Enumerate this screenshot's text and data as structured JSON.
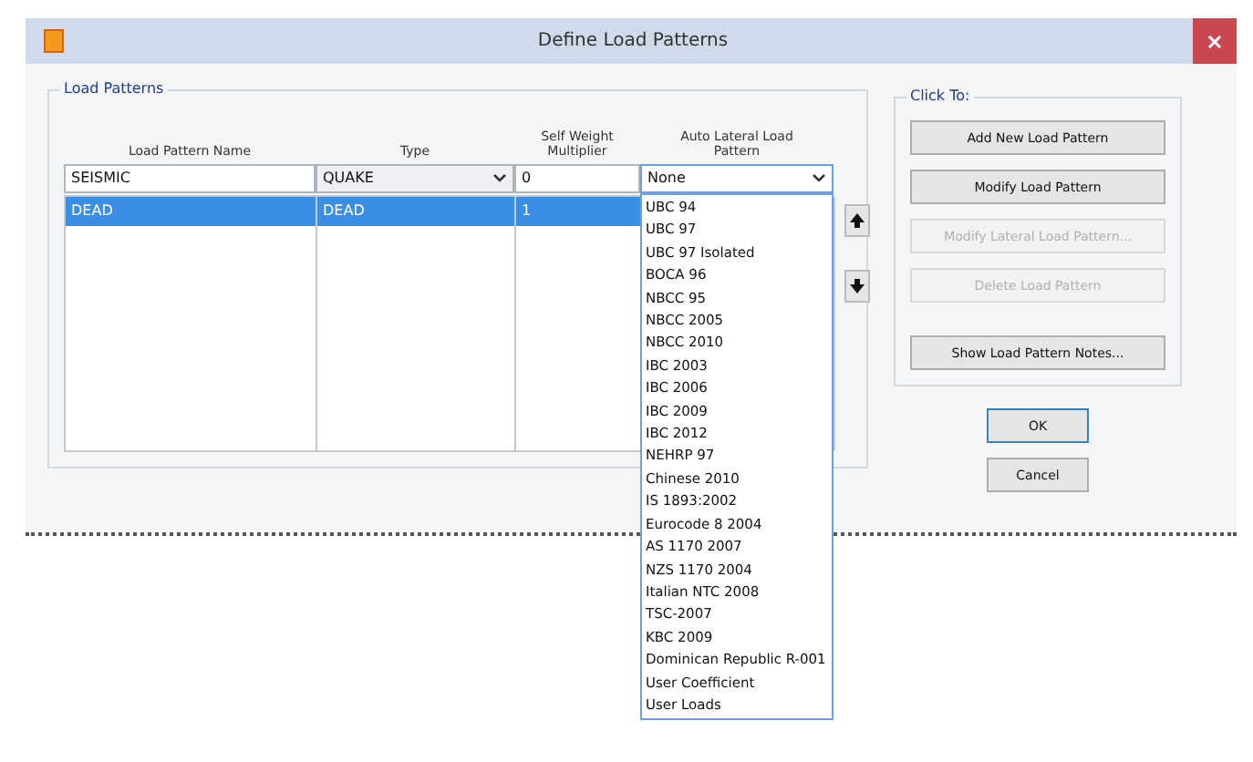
{
  "window": {
    "title": "Define Load Patterns"
  },
  "load_patterns": {
    "title": "Load Patterns",
    "columns": [
      "Load Pattern Name",
      "Type",
      "Self Weight Multiplier",
      "Auto Lateral Load Pattern"
    ],
    "input": {
      "name": "SEISMIC",
      "type": "QUAKE",
      "multiplier": "0",
      "auto_lateral": "None"
    },
    "rows": [
      {
        "name": "DEAD",
        "type": "DEAD",
        "multiplier": "1",
        "selected": true
      }
    ],
    "auto_lateral_options": [
      "UBC 94",
      "UBC 97",
      "UBC 97 Isolated",
      "BOCA 96",
      "NBCC 95",
      "NBCC 2005",
      "NBCC 2010",
      "IBC 2003",
      "IBC 2006",
      "IBC 2009",
      "IBC 2012",
      "NEHRP 97",
      "Chinese 2010",
      "IS 1893:2002",
      "Eurocode 8 2004",
      "AS 1170 2007",
      "NZS 1170 2004",
      "Italian NTC 2008",
      "TSC-2007",
      "KBC 2009",
      "Dominican Republic R-001",
      "User Coefficient",
      "User Loads"
    ]
  },
  "click_to": {
    "title": "Click To:",
    "buttons": [
      {
        "label": "Add New Load Pattern",
        "disabled": false
      },
      {
        "label": "Modify Load Pattern",
        "disabled": false
      },
      {
        "label": "Modify Lateral Load Pattern...",
        "disabled": true
      },
      {
        "label": "Delete Load Pattern",
        "disabled": true
      },
      {
        "label": "Show Load Pattern Notes...",
        "disabled": false
      }
    ]
  },
  "buttons": [
    "OK",
    "Cancel"
  ]
}
